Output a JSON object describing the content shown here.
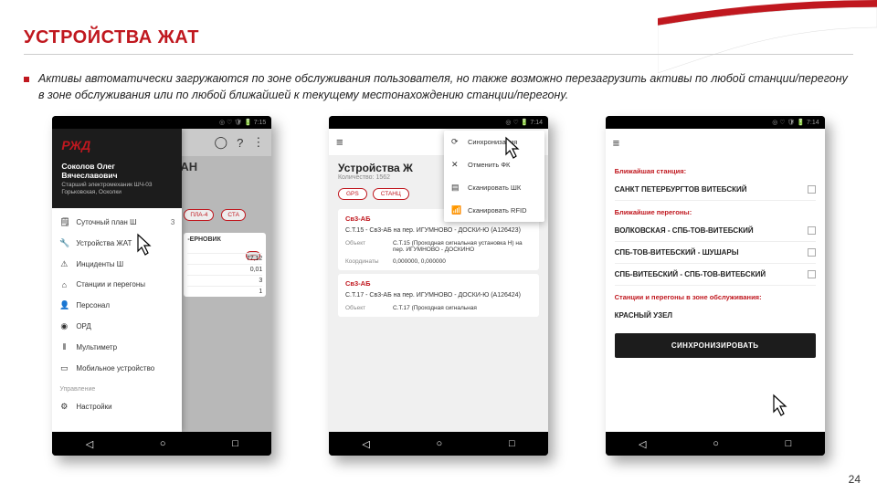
{
  "page": {
    "title": "УСТРОЙСТВА ЖАТ",
    "description": "Активы автоматически загружаются по зоне обслуживания пользователя, но также возможно перезагрузить активы по любой станции/перегону в зоне обслуживания или по любой ближайшей к текущему местонахождению станции/перегону.",
    "number": "24"
  },
  "phone1": {
    "status": "◎ ♡ 🛡 🔋 7:15",
    "title_partial": "АН",
    "chip1": "ПЛА-4",
    "chip2": "СТА",
    "card_title": "-ЕРНОВИК",
    "row1_v": "77,12",
    "row2_v": "0,01",
    "row3_v": "3",
    "row4_v": "1",
    "logo": "РЖД",
    "user_name": "Соколов Олег Вячеславович",
    "user_role": "Старший электромеханик\nШЧ-03 Горьковская, Осколки",
    "menu": [
      {
        "ico": "🗒",
        "label": "Суточный план Ш",
        "count": "3"
      },
      {
        "ico": "🔧",
        "label": "Устройства ЖАТ",
        "count": ""
      },
      {
        "ico": "⚠",
        "label": "Инциденты Ш",
        "count": ""
      },
      {
        "ico": "⌂",
        "label": "Станции и перегоны",
        "count": ""
      },
      {
        "ico": "👤",
        "label": "Персонал",
        "count": ""
      },
      {
        "ico": "◉",
        "label": "ОРД",
        "count": ""
      },
      {
        "ico": "⦀",
        "label": "Мультиметр",
        "count": ""
      },
      {
        "ico": "▭",
        "label": "Мобильное устройство",
        "count": ""
      }
    ],
    "section": "Управление",
    "settings": {
      "ico": "⚙",
      "label": "Настройки"
    }
  },
  "phone2": {
    "status": "◎ ♡ 🔋 7:14",
    "title": "Устройства Ж",
    "subtitle": "Количество: 1562",
    "chip1": "GPS",
    "chip2": "СТАНЦ",
    "popup": [
      {
        "ico": "⟳",
        "label": "Синхронизация"
      },
      {
        "ico": "✕",
        "label": "Отменить ФК"
      },
      {
        "ico": "▤",
        "label": "Сканировать ШК"
      },
      {
        "ico": "📶",
        "label": "Сканировать RFID"
      }
    ],
    "card1": {
      "head": "Св3-АБ",
      "title": "С.Т.15 - Св3-АБ на пер. ИГУМНОВО - ДОСКИ-Ю (А126423)",
      "obj_l": "Объект",
      "obj_v": "С.Т.15 (Проходная сигнальная установка Н) на пер. ИГУМНОВО - ДОСКИНО",
      "coord_l": "Координаты",
      "coord_v": "0,000000, 0,000000"
    },
    "card2": {
      "head": "Св3-АБ",
      "title": "С.Т.17 - Св3-АБ на пер. ИГУМНОВО - ДОСКИ-Ю (А126424)",
      "obj_l": "Объект",
      "obj_v": "С.Т.17 (Проходная сигнальная"
    }
  },
  "phone3": {
    "status": "◎ ♡ 🛡 🔋 7:14",
    "sec1": "Ближайшая станция:",
    "st1": "САНКТ ПЕТЕРБУРГТОВ ВИТЕБСКИЙ",
    "sec2": "Ближайшие перегоны:",
    "st2": "ВОЛКОВСКАЯ - СПБ-ТОВ-ВИТЕБСКИЙ",
    "st3": "СПБ-ТОВ-ВИТЕБСКИЙ - ШУШАРЫ",
    "st4": "СПБ-ВИТЕБСКИЙ - СПБ-ТОВ-ВИТЕБСКИЙ",
    "sec3": "Станции и перегоны в зоне обслуживания:",
    "st5": "КРАСНЫЙ УЗЕЛ",
    "btn": "СИНХРОНИЗИРОВАТЬ"
  }
}
